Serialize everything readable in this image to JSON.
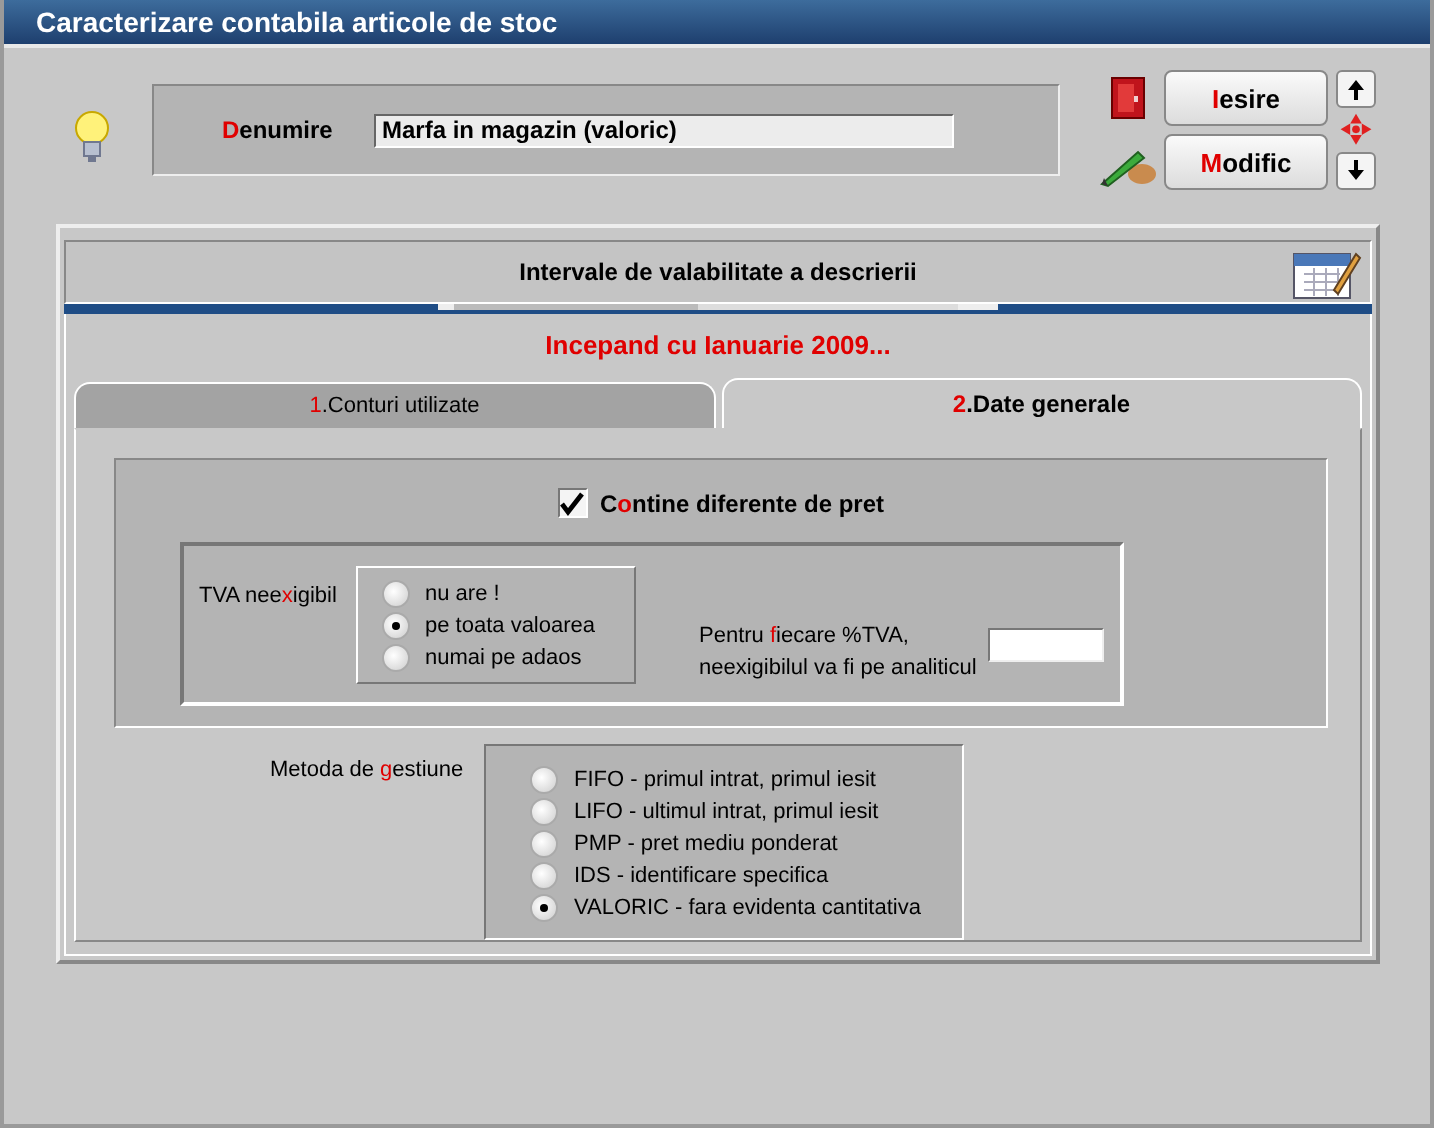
{
  "window": {
    "title": "Caracterizare contabila articole de stoc"
  },
  "name_field": {
    "label": {
      "key": "D",
      "post": "enumire"
    },
    "value": "Marfa in magazin (valoric)"
  },
  "buttons": [
    {
      "kind": "exit",
      "label": {
        "key": "I",
        "post": "esire"
      }
    },
    {
      "kind": "edit",
      "label": {
        "key": "M",
        "post": "odific"
      }
    }
  ],
  "intervals": {
    "title": "Intervale de valabilitate a descrierii",
    "period": "Incepand cu Ianuarie 2009..."
  },
  "tabs": [
    {
      "label": {
        "key": "1",
        "post": ".Conturi utilizate"
      },
      "selected": false
    },
    {
      "label": {
        "key": "2",
        "post": ".Date generale"
      },
      "selected": true
    }
  ],
  "price_differences": {
    "label": {
      "pre": "C",
      "key": "o",
      "post": "ntine diferente de pret"
    },
    "checked": true
  },
  "vat": {
    "label": {
      "pre": "TVA nee",
      "key": "x",
      "post": "igibil"
    },
    "options": [
      {
        "label": "nu are !",
        "selected": false
      },
      {
        "label": "pe toata valoarea",
        "selected": true
      },
      {
        "label": "numai pe adaos",
        "selected": false
      }
    ],
    "note": {
      "pre": "Pentru ",
      "key": "f",
      "post": "iecare %TVA,\nneexigibilul va fi pe analiticul"
    }
  },
  "method": {
    "label": {
      "pre": "Metoda de ",
      "key": "g",
      "post": "estiune"
    },
    "options": [
      {
        "label": "FIFO - primul intrat, primul iesit",
        "selected": false
      },
      {
        "label": "LIFO - ultimul intrat, primul iesit",
        "selected": false
      },
      {
        "label": "PMP - pret mediu ponderat",
        "selected": false
      },
      {
        "label": "IDS - identificare specifica",
        "selected": false
      },
      {
        "label": "VALORIC - fara evidenta cantitativa",
        "selected": true
      }
    ]
  }
}
